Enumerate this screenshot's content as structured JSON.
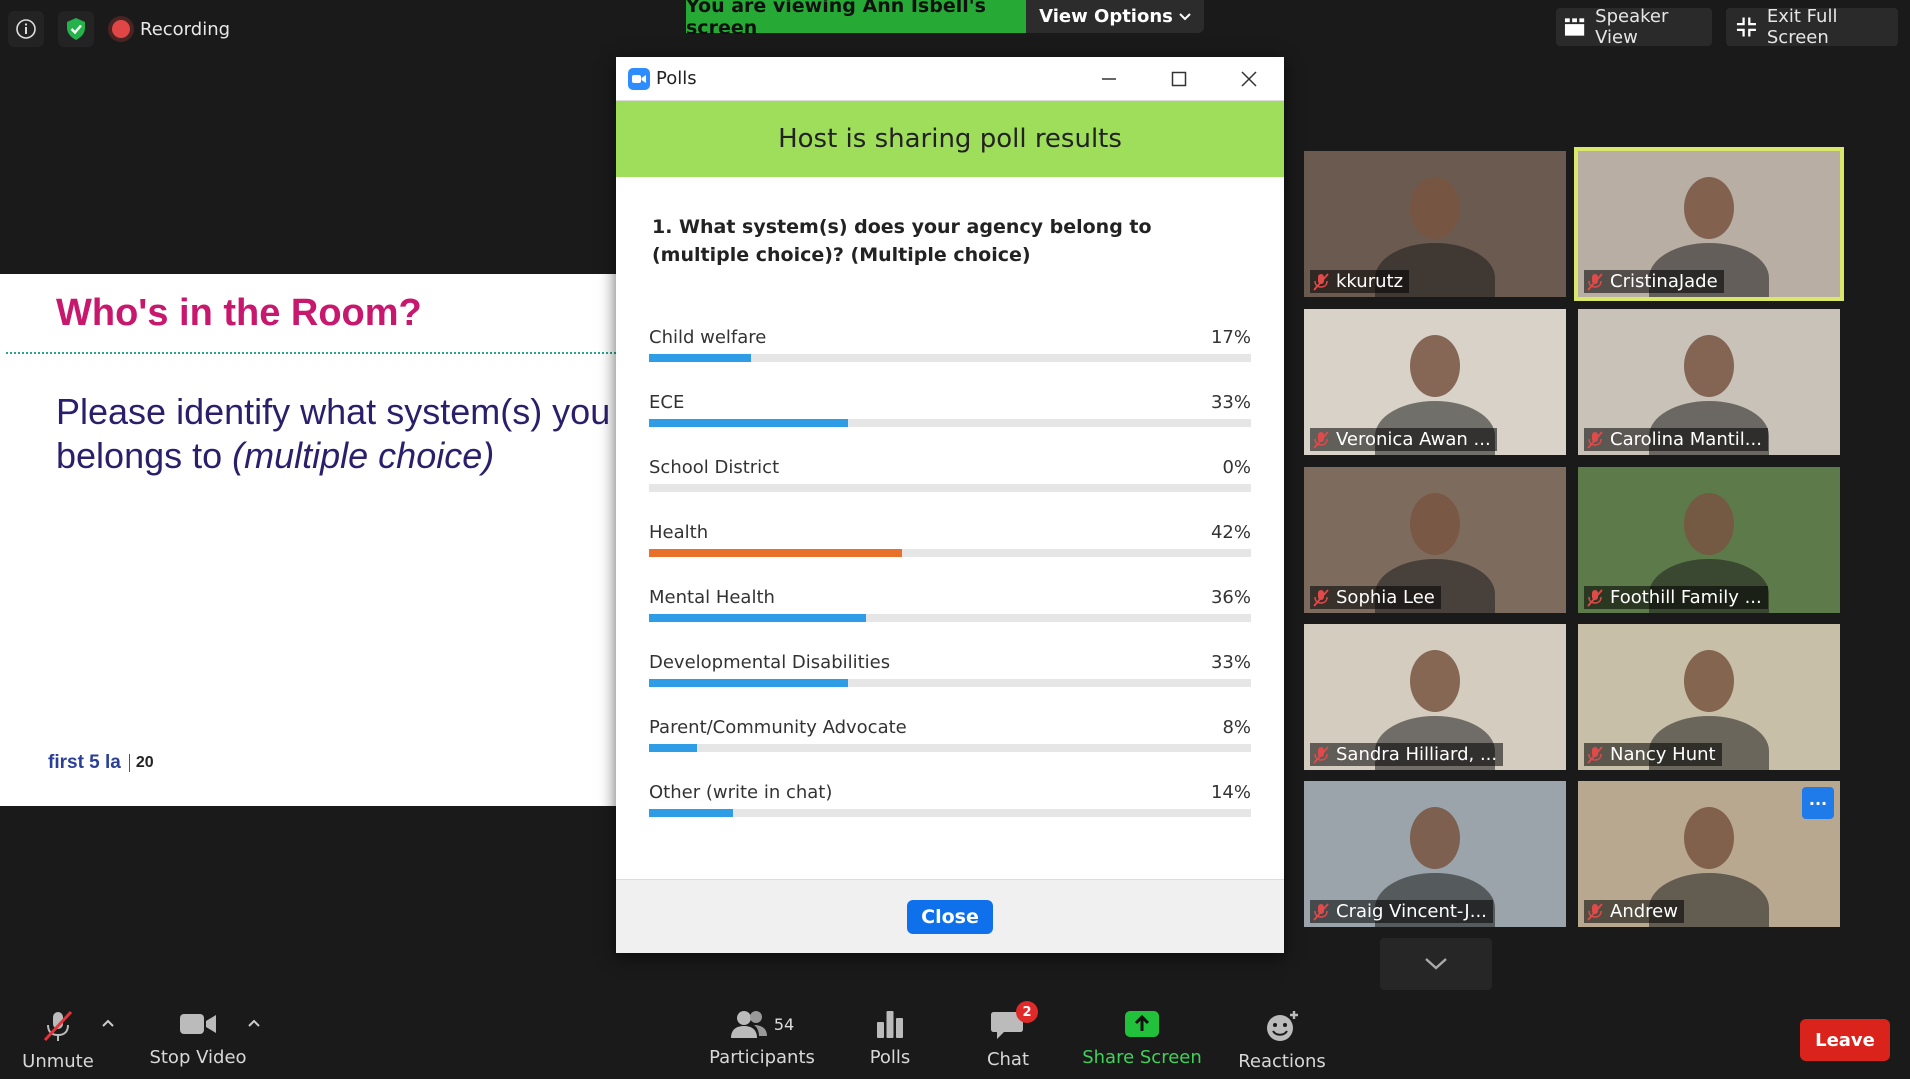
{
  "topbar": {
    "recording_label": "Recording",
    "viewing_banner": "You are viewing Ann Isbell's screen",
    "view_options_label": "View Options",
    "speaker_view_label": "Speaker View",
    "exit_full_screen_label": "Exit Full Screen"
  },
  "slide": {
    "title": "Who's in the Room?",
    "body_line1": "Please identify what system(s) you",
    "body_line2_prefix": "belongs to ",
    "body_line2_italic": "(multiple choice)",
    "logo_text": "first 5 la",
    "logo_badge": "20"
  },
  "polls": {
    "window_title": "Polls",
    "header": "Host is sharing poll results",
    "question": "1. What system(s) does your agency belong to (multiple choice)? (Multiple choice)",
    "close_label": "Close",
    "options": [
      {
        "label": "Child welfare",
        "pct_text": "17%",
        "value": 17,
        "color": "#2f9ce6"
      },
      {
        "label": "ECE",
        "pct_text": "33%",
        "value": 33,
        "color": "#2f9ce6"
      },
      {
        "label": "School District",
        "pct_text": "0%",
        "value": 0,
        "color": "#2f9ce6"
      },
      {
        "label": "Health",
        "pct_text": "42%",
        "value": 42,
        "color": "#e8712a"
      },
      {
        "label": "Mental Health",
        "pct_text": "36%",
        "value": 36,
        "color": "#2f9ce6"
      },
      {
        "label": "Developmental Disabilities",
        "pct_text": "33%",
        "value": 33,
        "color": "#2f9ce6"
      },
      {
        "label": "Parent/Community Advocate",
        "pct_text": "8%",
        "value": 8,
        "color": "#2f9ce6"
      },
      {
        "label": "Other (write in chat)",
        "pct_text": "14%",
        "value": 14,
        "color": "#2f9ce6"
      }
    ]
  },
  "gallery": {
    "participants": [
      {
        "name": "kkurutz",
        "bg": "#6b5a4f"
      },
      {
        "name": "CristinaJade",
        "bg": "#b8aea3",
        "active": true
      },
      {
        "name": "Veronica Awan ...",
        "bg": "#d8d2c8"
      },
      {
        "name": "Carolina Mantil...",
        "bg": "#c9c2b8"
      },
      {
        "name": "Sophia Lee",
        "bg": "#7d6b5e"
      },
      {
        "name": "Foothill Family ...",
        "bg": "#5d7a4a"
      },
      {
        "name": "Sandra Hilliard, ...",
        "bg": "#d5ccc0"
      },
      {
        "name": "Nancy Hunt",
        "bg": "#c8bfa8"
      },
      {
        "name": "Craig Vincent-J...",
        "bg": "#9aa4aa"
      },
      {
        "name": "Andrew",
        "bg": "#b9a890"
      }
    ]
  },
  "toolbar": {
    "unmute_label": "Unmute",
    "stop_video_label": "Stop Video",
    "participants_label": "Participants",
    "participants_count": "54",
    "polls_label": "Polls",
    "chat_label": "Chat",
    "chat_badge": "2",
    "share_screen_label": "Share Screen",
    "reactions_label": "Reactions",
    "leave_label": "Leave"
  }
}
